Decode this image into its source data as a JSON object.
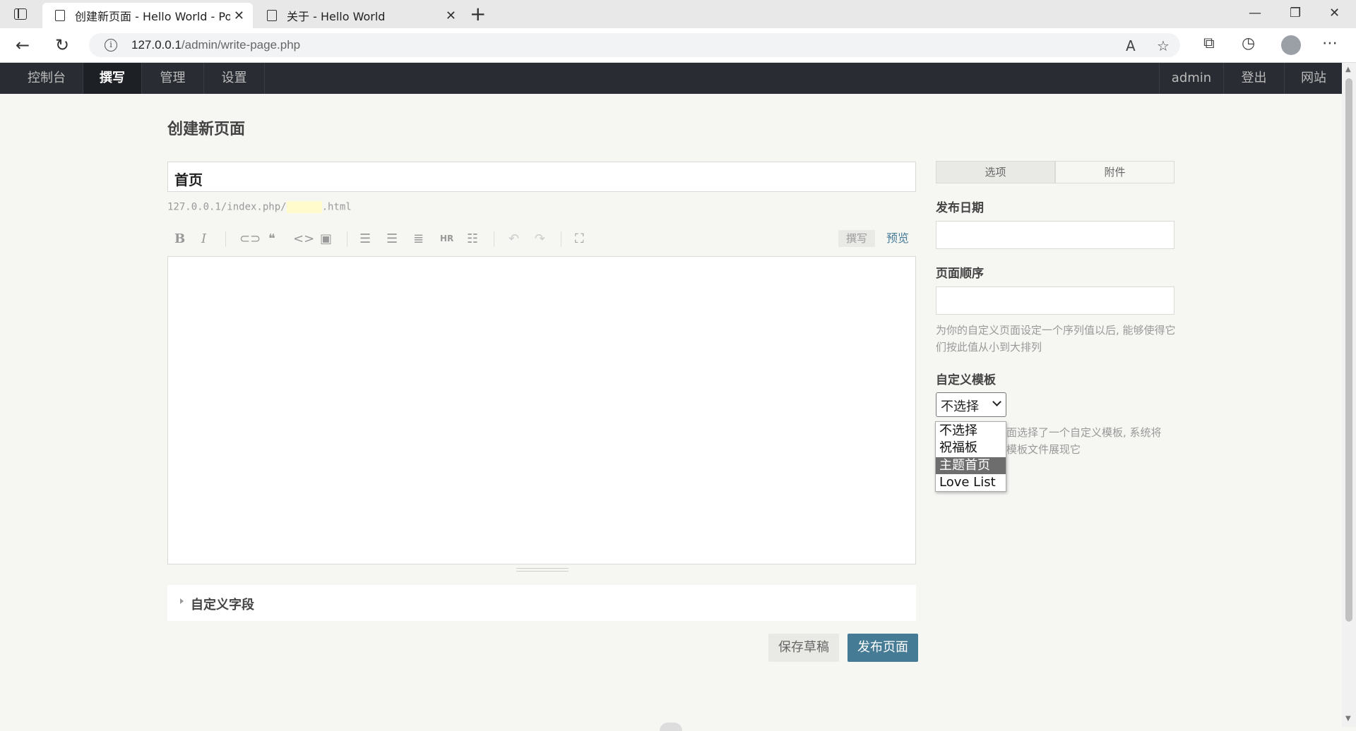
{
  "browser": {
    "tabs": [
      {
        "title": "创建新页面 - Hello World - Powe",
        "active": true
      },
      {
        "title": "关于 - Hello World",
        "active": false
      }
    ],
    "url_host": "127.0.0.1",
    "url_path": "/admin/write-page.php"
  },
  "admin_nav": {
    "left": [
      "控制台",
      "撰写",
      "管理",
      "设置"
    ],
    "current": "撰写",
    "right": [
      "admin",
      "登出",
      "网站"
    ]
  },
  "page": {
    "title": "创建新页面",
    "title_value": "首页",
    "slug_prefix": "127.0.0.1/index.php/",
    "slug_suffix": ".html"
  },
  "editor": {
    "mode_write": "撰写",
    "mode_preview": "预览"
  },
  "custom_fields_label": "自定义字段",
  "buttons": {
    "save_draft": "保存草稿",
    "publish": "发布页面"
  },
  "sidebar": {
    "tabs": [
      "选项",
      "附件"
    ],
    "publish_date_label": "发布日期",
    "order_label": "页面顺序",
    "order_desc": "为你的自定义页面设定一个序列值以后, 能够使得它们按此值从小到大排列",
    "template_label": "自定义模板",
    "template_selected": "不选择",
    "template_options": [
      "不选择",
      "祝福板",
      "主题首页",
      "Love List"
    ],
    "template_highlighted": "主题首页",
    "template_desc_line1": "面选择了一个自定义模板, 系统将",
    "template_desc_line2": "模板文件展现它"
  },
  "colors": {
    "admin_nav_bg": "#292d33",
    "primary_button": "#467b96",
    "page_bg": "#f6f6f3"
  }
}
